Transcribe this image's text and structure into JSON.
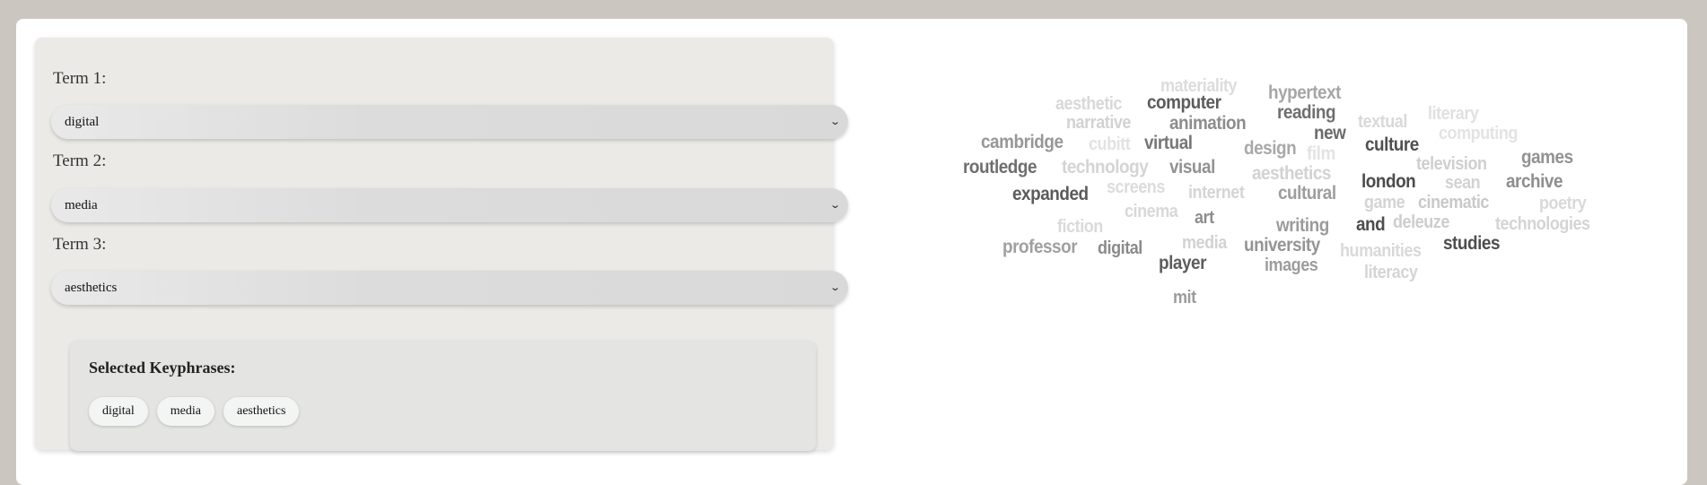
{
  "form": {
    "term1": {
      "label": "Term 1:",
      "value": "digital"
    },
    "term2": {
      "label": "Term 2:",
      "value": "media"
    },
    "term3": {
      "label": "Term 3:",
      "value": "aesthetics"
    }
  },
  "keyphrases": {
    "title": "Selected Keyphrases:",
    "items": [
      "digital",
      "media",
      "aesthetics"
    ]
  },
  "word_cloud": {
    "words": [
      {
        "text": "materiality",
        "color": "#dcdcdc"
      },
      {
        "text": "hypertext",
        "color": "#a6a6a6"
      },
      {
        "text": "aesthetic",
        "color": "#d8d8d8"
      },
      {
        "text": "computer",
        "color": "#5b5b5b"
      },
      {
        "text": "reading",
        "color": "#6f6f6f"
      },
      {
        "text": "literary",
        "color": "#e0e0e0"
      },
      {
        "text": "narrative",
        "color": "#d2d2d2"
      },
      {
        "text": "animation",
        "color": "#8d8d8d"
      },
      {
        "text": "textual",
        "color": "#d9d9d9"
      },
      {
        "text": "new",
        "color": "#6b6b6b"
      },
      {
        "text": "computing",
        "color": "#e3e3e3"
      },
      {
        "text": "cambridge",
        "color": "#979797"
      },
      {
        "text": "cubitt",
        "color": "#e2e2e2"
      },
      {
        "text": "virtual",
        "color": "#777777"
      },
      {
        "text": "design",
        "color": "#a8a8a8"
      },
      {
        "text": "film",
        "color": "#e3e3e3"
      },
      {
        "text": "culture",
        "color": "#4f4f4f"
      },
      {
        "text": "games",
        "color": "#929292"
      },
      {
        "text": "routledge",
        "color": "#6e6e6e"
      },
      {
        "text": "technology",
        "color": "#d4d4d4"
      },
      {
        "text": "visual",
        "color": "#929292"
      },
      {
        "text": "aesthetics",
        "color": "#d2d2d2"
      },
      {
        "text": "television",
        "color": "#cfcfcf"
      },
      {
        "text": "london",
        "color": "#4b4b4b"
      },
      {
        "text": "sean",
        "color": "#d2d2d2"
      },
      {
        "text": "archive",
        "color": "#8e8e8e"
      },
      {
        "text": "expanded",
        "color": "#5b5b5b"
      },
      {
        "text": "screens",
        "color": "#dcdcdc"
      },
      {
        "text": "internet",
        "color": "#d5d5d5"
      },
      {
        "text": "cultural",
        "color": "#9d9d9d"
      },
      {
        "text": "game",
        "color": "#d4d4d4"
      },
      {
        "text": "cinematic",
        "color": "#c9c9c9"
      },
      {
        "text": "poetry",
        "color": "#d9d9d9"
      },
      {
        "text": "cinema",
        "color": "#d8d8d8"
      },
      {
        "text": "art",
        "color": "#8d8d8d"
      },
      {
        "text": "fiction",
        "color": "#dadada"
      },
      {
        "text": "writing",
        "color": "#9b9b9b"
      },
      {
        "text": "and",
        "color": "#4d4d4d"
      },
      {
        "text": "deleuze",
        "color": "#cdcdcd"
      },
      {
        "text": "technologies",
        "color": "#d4d4d4"
      },
      {
        "text": "professor",
        "color": "#a0a0a0"
      },
      {
        "text": "digital",
        "color": "#8a8a8a"
      },
      {
        "text": "media",
        "color": "#d2d2d2"
      },
      {
        "text": "university",
        "color": "#949494"
      },
      {
        "text": "humanities",
        "color": "#d9d9d9"
      },
      {
        "text": "studies",
        "color": "#4e4e4e"
      },
      {
        "text": "player",
        "color": "#5d5d5d"
      },
      {
        "text": "images",
        "color": "#9d9d9d"
      },
      {
        "text": "literacy",
        "color": "#d4d4d4"
      },
      {
        "text": "mit",
        "color": "#9b9b9b"
      }
    ]
  }
}
